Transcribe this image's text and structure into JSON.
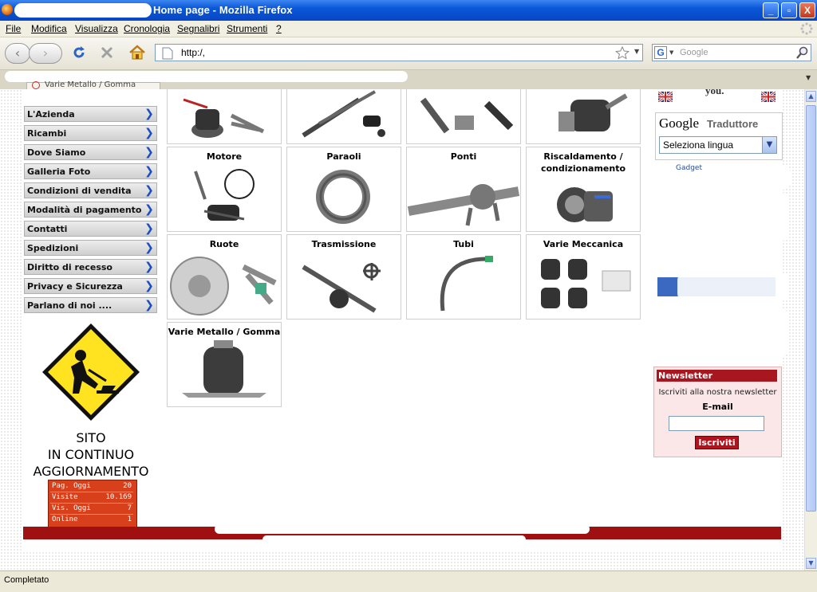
{
  "window": {
    "title": "Home page - Mozilla Firefox",
    "minimize": "_",
    "maximize": "▫",
    "close": "X"
  },
  "menu": [
    "File",
    "Modifica",
    "Visualizza",
    "Cronologia",
    "Segnalibri",
    "Strumenti",
    "?"
  ],
  "navbar": {
    "url": "http:/,",
    "search_placeholder": "Google"
  },
  "tabs": {
    "active_tab": "Varie Metallo / Gomma"
  },
  "sidebar": {
    "items": [
      "L'Azienda",
      "Ricambi",
      "Dove Siamo",
      "Galleria Foto",
      "Condizioni di vendita",
      "Modalità di pagamento",
      "Contatti",
      "Spedizioni",
      "Diritto di recesso",
      "Privacy e Sicurezza",
      "Parlano di noi ...."
    ],
    "notice_line1": "SITO",
    "notice_line2": "IN CONTINUO",
    "notice_line3": "AGGIORNAMENTO"
  },
  "counter": [
    {
      "label": "Pag. Oggi",
      "value": "20"
    },
    {
      "label": "Visite",
      "value": "10.169"
    },
    {
      "label": "Vis. Oggi",
      "value": "7"
    },
    {
      "label": "Online",
      "value": "1"
    }
  ],
  "products": [
    "Motore",
    "Paraoli",
    "Ponti",
    "Riscaldamento / condizionamento",
    "Ruote",
    "Trasmissione",
    "Tubi",
    "Varie Meccanica",
    "Varie Metallo / Gomma"
  ],
  "right": {
    "top_text": "you.",
    "google_logo": "Google",
    "translate_label": "Traduttore",
    "select_language": "Seleziona lingua",
    "gadget": "Gadget"
  },
  "newsletter": {
    "header": "Newsletter",
    "subtitle": "Iscriviti alla nostra newsletter",
    "email_label": "E-mail",
    "button": "Iscriviti"
  },
  "status": {
    "text": "Completato"
  }
}
